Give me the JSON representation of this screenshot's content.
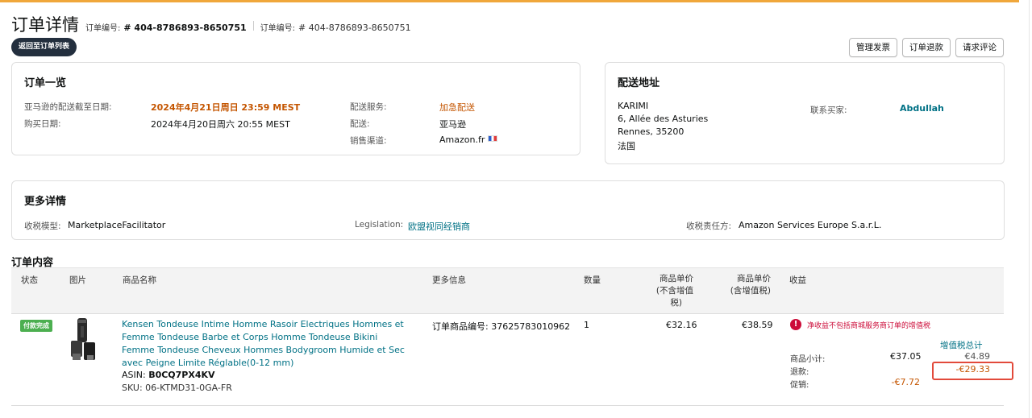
{
  "header": {
    "title": "订单详情",
    "order_id_label_1": "订单编号:",
    "order_id_value_1": "# 404-8786893-8650751",
    "order_id_label_2": "订单编号:",
    "order_id_value_2": "# 404-8786893-8650751",
    "back_button": "返回至订单列表",
    "actions": [
      "管理发票",
      "订单退款",
      "请求评论"
    ]
  },
  "order_summary": {
    "title": "订单一览",
    "ship_by_label": "亚马逊的配送截至日期:",
    "ship_by_value": "2024年4月21日周日 23:59 MEST",
    "purchase_date_label": "购买日期:",
    "purchase_date_value": "2024年4月20日周六 20:55 MEST",
    "shipping_service_label": "配送服务:",
    "shipping_service_value": "加急配送",
    "fulfillment_label": "配送:",
    "fulfillment_value": "亚马逊",
    "sales_channel_label": "销售渠道:",
    "sales_channel_value": "Amazon.fr"
  },
  "shipping_address": {
    "title": "配送地址",
    "name": "KARIMI",
    "line1": "6, Allée des Asturies",
    "line2": "Rennes, 35200",
    "country": "法国",
    "contact_label": "联系买家:",
    "contact_value": "Abdullah"
  },
  "more_details": {
    "title": "更多详情",
    "tax_model_label": "收税模型:",
    "tax_model_value": "MarketplaceFacilitator",
    "legislation_label": "Legislation:",
    "legislation_value": "欧盟视同经销商",
    "tax_responsible_label": "收税责任方:",
    "tax_responsible_value": "Amazon Services Europe S.a.r.L."
  },
  "order_contents": {
    "title": "订单内容",
    "columns": {
      "status": "状态",
      "image": "图片",
      "product_name": "商品名称",
      "more_info": "更多信息",
      "quantity": "数量",
      "unit_price_excl_1": "商品单价",
      "unit_price_excl_2": "(不含增值",
      "unit_price_excl_3": "税)",
      "unit_price_incl_1": "商品单价",
      "unit_price_incl_2": "(含增值税)",
      "proceeds": "收益"
    },
    "row": {
      "status_badge": "付款完成",
      "product_name": "Kensen Tondeuse Intime Homme Rasoir Electriques Hommes et Femme Tondeuse Barbe et Corps Homme Tondeuse Bikini Femme Tondeuse Cheveux Hommes Bodygroom Humide et Sec avec Peigne Limite Réglable(0-12 mm)",
      "asin_label": "ASIN: ",
      "asin_value": "B0CQ7PX4KV",
      "sku": "SKU: 06-KTMD31-0GA-FR",
      "more_info": "订单商品编号: 37625783010962",
      "quantity": "1",
      "unit_price_excl": "€32.16",
      "unit_price_incl": "€38.59",
      "alert_text": "净收益不包括商城服务商订单的增值税",
      "vat_total_header": "增值税总计",
      "subtotal_label": "商品小计:",
      "subtotal_value": "€37.05",
      "subtotal_vat": "€4.89",
      "refund_label": "退款:",
      "refund_vat": "-€29.33",
      "promo_label": "促销:",
      "promo_value": "-€7.72"
    }
  },
  "colors": {
    "accent_orange": "#c45500",
    "link_teal": "#007185",
    "alert_red": "#cc0c39",
    "paid_green": "#4caf50",
    "header_bar": "#f0a73b"
  }
}
